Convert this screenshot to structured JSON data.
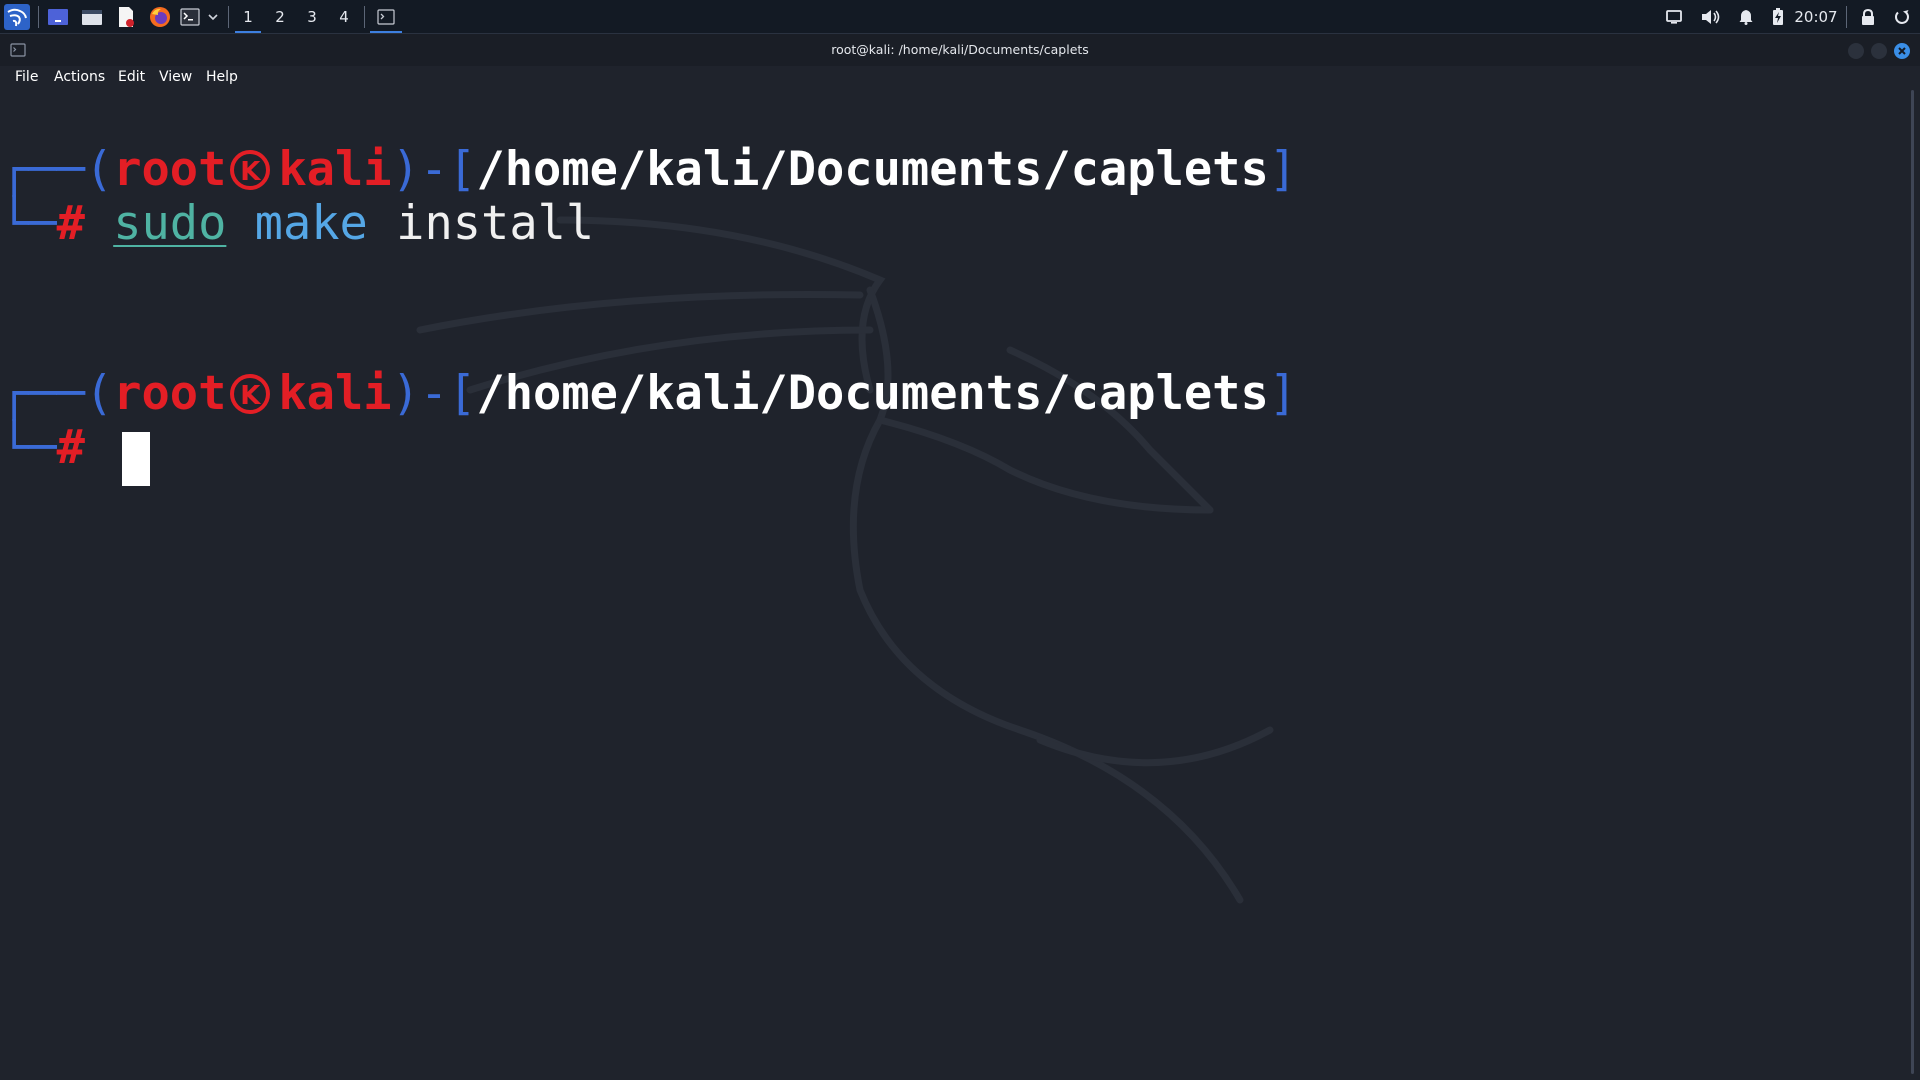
{
  "panel": {
    "launchers": [
      {
        "name": "kali-menu-icon"
      },
      {
        "name": "show-desktop-icon"
      },
      {
        "name": "file-manager-icon"
      },
      {
        "name": "text-editor-icon"
      },
      {
        "name": "firefox-icon"
      },
      {
        "name": "terminal-icon"
      }
    ],
    "workspaces": [
      "1",
      "2",
      "3",
      "4"
    ],
    "active_workspace": "1",
    "clock": "20:07"
  },
  "window": {
    "title": "root@kali: /home/kali/Documents/caplets"
  },
  "menu": [
    "File",
    "Actions",
    "Edit",
    "View",
    "Help"
  ],
  "terminal": {
    "prompt1": {
      "open": "┌──(",
      "user": "root",
      "host": "kali",
      "mid": ")-[",
      "cwd": "/home/kali/Documents/caplets",
      "close": "]",
      "corner": "└─",
      "hash": "#",
      "cmd_sudo": "sudo",
      "cmd_make": "make",
      "cmd_arg": "install"
    },
    "prompt2": {
      "open": "┌──(",
      "user": "root",
      "host": "kali",
      "mid": ")-[",
      "cwd": "/home/kali/Documents/caplets",
      "close": "]",
      "corner": "└─",
      "hash": "#"
    }
  },
  "colors": {
    "background": "#1f232c",
    "prompt_box": "#3a6ad6",
    "prompt_user": "#e31e25",
    "path": "#ffffff",
    "cmd_sudo": "#4fb3a3",
    "cmd_make": "#55a7e6",
    "panel_accent": "#3d7fe0"
  }
}
